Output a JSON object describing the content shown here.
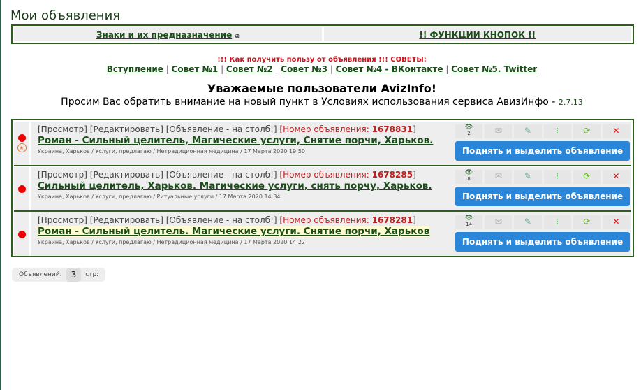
{
  "page_title": "Мои объявления",
  "signs_link": "Знаки и их предназначение",
  "functions_link": "!! ФУНКЦИИ КНОПОК !!",
  "tips_heading": "!!! Как получить пользу от объявления !!! СОВЕТЫ:",
  "tips": [
    "Вступление",
    "Совет №1",
    "Совет №2",
    "Совет №3",
    "Совет №4 - ВКонтакте",
    "Совет №5. Twitter"
  ],
  "notice_title": "Уважаемые пользователи AvizInfo!",
  "notice_text": "Просим Вас обратить внимание на новый пункт в Условиях использования сервиса АвизИнфо - ",
  "notice_link": "2.7.13",
  "labels": {
    "view": "[Просмотр]",
    "edit": "[Редактировать]",
    "pole": "[Объявление - на столб!]",
    "num": "[Номер объявления: ",
    "close": "]",
    "raise": "Поднять и выделить объявление"
  },
  "ads": [
    {
      "id": "1678831",
      "title": "Роман - Сильный целитель, Магические услуги, Снятие порчи, Харьков.",
      "meta": "Украина, Харьков / Услуги, предлагаю / Нетрадиционная медицина / 17 Марта 2020 19:50",
      "views": "2"
    },
    {
      "id": "1678285",
      "title": "Сильный целитель, Харьков. Магические услуги, снять порчу, Харьков.",
      "meta": "Украина, Харьков / Услуги, предлагаю / Ритуальные услуги / 17 Марта 2020 14:34",
      "views": "8"
    },
    {
      "id": "1678281",
      "title": "Роман - Сильный целитель. Магические услуги. Снятие порчи, Харьков",
      "meta": "Украина, Харьков / Услуги, предлагаю / Нетрадиционная медицина / 17 Марта 2020 14:22",
      "views": "14"
    }
  ],
  "pager": {
    "label": "Объявлений:",
    "count": "3",
    "pages": "стр:"
  }
}
